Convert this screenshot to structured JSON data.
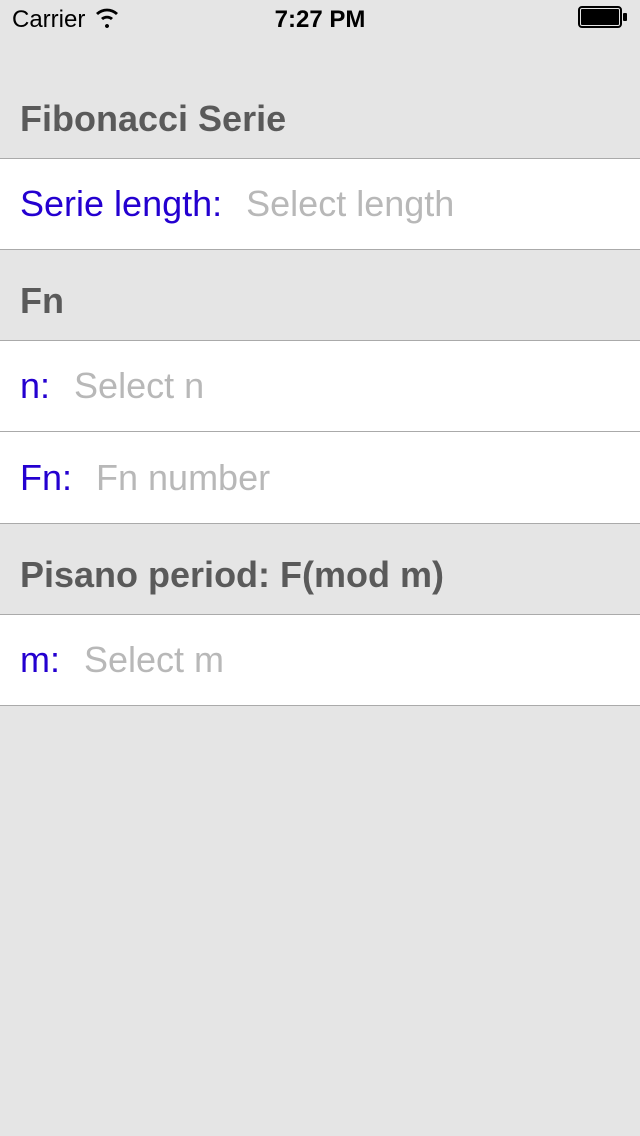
{
  "status_bar": {
    "carrier": "Carrier",
    "time": "7:27 PM"
  },
  "sections": {
    "fibonacci": {
      "header": "Fibonacci Serie",
      "serie_length_label": "Serie length:",
      "serie_length_placeholder": "Select length"
    },
    "fn": {
      "header": "Fn",
      "n_label": "n:",
      "n_placeholder": "Select n",
      "fn_label": "Fn:",
      "fn_placeholder": "Fn number"
    },
    "pisano": {
      "header": "Pisano period: F(mod m)",
      "m_label": "m:",
      "m_placeholder": "Select m"
    }
  },
  "colors": {
    "label_color": "#2400d0",
    "header_color": "#5a5a5a",
    "placeholder_color": "#b8b8b8",
    "background": "#e5e5e5"
  }
}
